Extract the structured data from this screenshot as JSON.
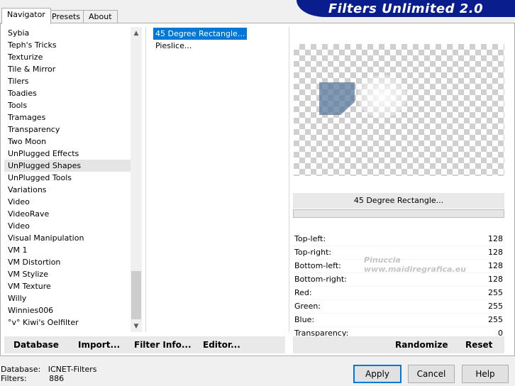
{
  "tabs": [
    "Navigator",
    "Presets",
    "About"
  ],
  "banner_title": "Filters Unlimited 2.0",
  "categories": [
    "Sybia",
    "Teph's Tricks",
    "Texturize",
    "Tile & Mirror",
    "Tilers",
    "Toadies",
    "Tools",
    "Tramages",
    "Transparency",
    "Two Moon",
    "UnPlugged Effects",
    "UnPlugged Shapes",
    "UnPlugged Tools",
    "Variations",
    "Video",
    "VideoRave",
    "Video",
    "Visual Manipulation",
    "VM 1",
    "VM Distortion",
    "VM Stylize",
    "VM Texture",
    "Willy",
    "Winnies006",
    "°v° Kiwi's Oelfilter"
  ],
  "selected_category": "UnPlugged Shapes",
  "filters": [
    "45 Degree Rectangle...",
    "Pieslice..."
  ],
  "selected_filter_name": "45 Degree Rectangle...",
  "params": [
    {
      "label": "Top-left:",
      "value": "128"
    },
    {
      "label": "Top-right:",
      "value": "128"
    },
    {
      "label": "Bottom-left:",
      "value": "128"
    },
    {
      "label": "Bottom-right:",
      "value": "128"
    },
    {
      "label": "Red:",
      "value": "255"
    },
    {
      "label": "Green:",
      "value": "255"
    },
    {
      "label": "Blue:",
      "value": "255"
    },
    {
      "label": "Transparency:",
      "value": "0"
    }
  ],
  "left_buttons": {
    "database": "Database",
    "import": "Import...",
    "filter_info": "Filter Info...",
    "editor": "Editor..."
  },
  "right_buttons": {
    "randomize": "Randomize",
    "reset": "Reset"
  },
  "status": {
    "database_label": "Database:",
    "database_value": "ICNET-Filters",
    "filters_label": "Filters:",
    "filters_value": "886"
  },
  "dialog_buttons": {
    "apply": "Apply",
    "cancel": "Cancel",
    "help": "Help"
  },
  "watermark": {
    "line1": "Pinuccia",
    "line2": "www.maidiregrafica.eu"
  }
}
